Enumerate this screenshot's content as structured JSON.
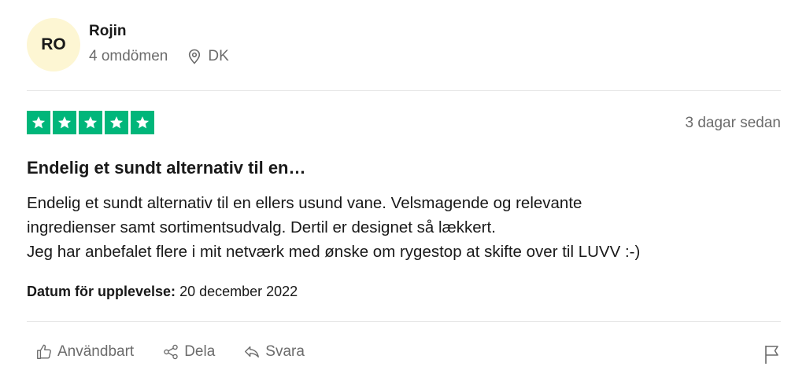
{
  "reviewer": {
    "initials": "RO",
    "name": "Rojin",
    "review_count": "4 omdömen",
    "location": "DK"
  },
  "review": {
    "rating": 5,
    "posted": "3 dagar sedan",
    "title": "Endelig et sundt alternativ til en…",
    "body_lines": [
      "Endelig et sundt alternativ til en ellers usund vane. Velsmagende og relevante",
      "ingredienser samt sortimentsudvalg. Dertil er designet så lækkert.",
      "Jeg har anbefalet flere i mit netværk med ønske om rygestop at skifte over til LUVV :-)"
    ],
    "experience_label": "Datum för upplevelse:",
    "experience_date": "20 december 2022"
  },
  "actions": {
    "useful": "Användbart",
    "share": "Dela",
    "reply": "Svara"
  },
  "colors": {
    "star_green": "#00b67a",
    "avatar_bg": "#fdf6d3",
    "muted_text": "#6b6b6b"
  }
}
